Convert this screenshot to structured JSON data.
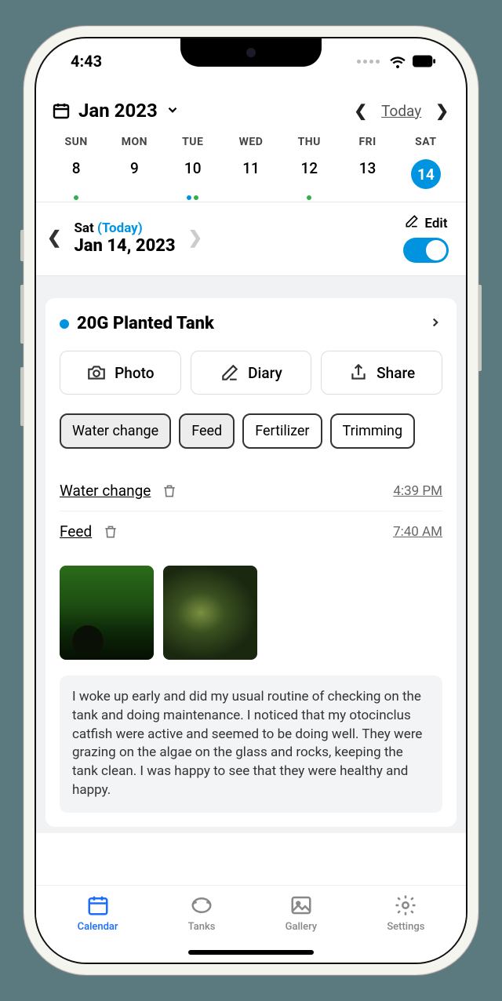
{
  "status": {
    "time": "4:43"
  },
  "header": {
    "month_label": "Jan 2023",
    "today_link": "Today"
  },
  "weekdays": [
    "SUN",
    "MON",
    "TUE",
    "WED",
    "THU",
    "FRI",
    "SAT"
  ],
  "dates": [
    {
      "d": "8",
      "dots": [
        "green"
      ],
      "selected": false
    },
    {
      "d": "9",
      "dots": [],
      "selected": false
    },
    {
      "d": "10",
      "dots": [
        "blue",
        "green"
      ],
      "selected": false
    },
    {
      "d": "11",
      "dots": [],
      "selected": false
    },
    {
      "d": "12",
      "dots": [
        "green"
      ],
      "selected": false
    },
    {
      "d": "13",
      "dots": [],
      "selected": false
    },
    {
      "d": "14",
      "dots": [
        "white"
      ],
      "selected": true
    }
  ],
  "day": {
    "weekday": "Sat",
    "today_label": "(Today)",
    "date_label": "Jan 14, 2023",
    "edit_label": "Edit"
  },
  "tank": {
    "name": "20G Planted Tank",
    "actions": {
      "photo": "Photo",
      "diary": "Diary",
      "share": "Share"
    },
    "tags": [
      {
        "label": "Water change",
        "active": true
      },
      {
        "label": "Feed",
        "active": true
      },
      {
        "label": "Fertilizer",
        "active": false
      },
      {
        "label": "Trimming",
        "active": false
      }
    ],
    "logs": [
      {
        "label": "Water change",
        "time": "4:39 PM"
      },
      {
        "label": "Feed",
        "time": "7:40 AM"
      }
    ],
    "diary_text": "I woke up early and did my usual routine of checking on the tank and doing maintenance. I noticed that my otocinclus catfish were active and seemed to be doing well. They were grazing on the algae on the glass and rocks, keeping the tank clean. I was happy to see that they were healthy and happy."
  },
  "tabs": {
    "calendar": "Calendar",
    "tanks": "Tanks",
    "gallery": "Gallery",
    "settings": "Settings"
  }
}
